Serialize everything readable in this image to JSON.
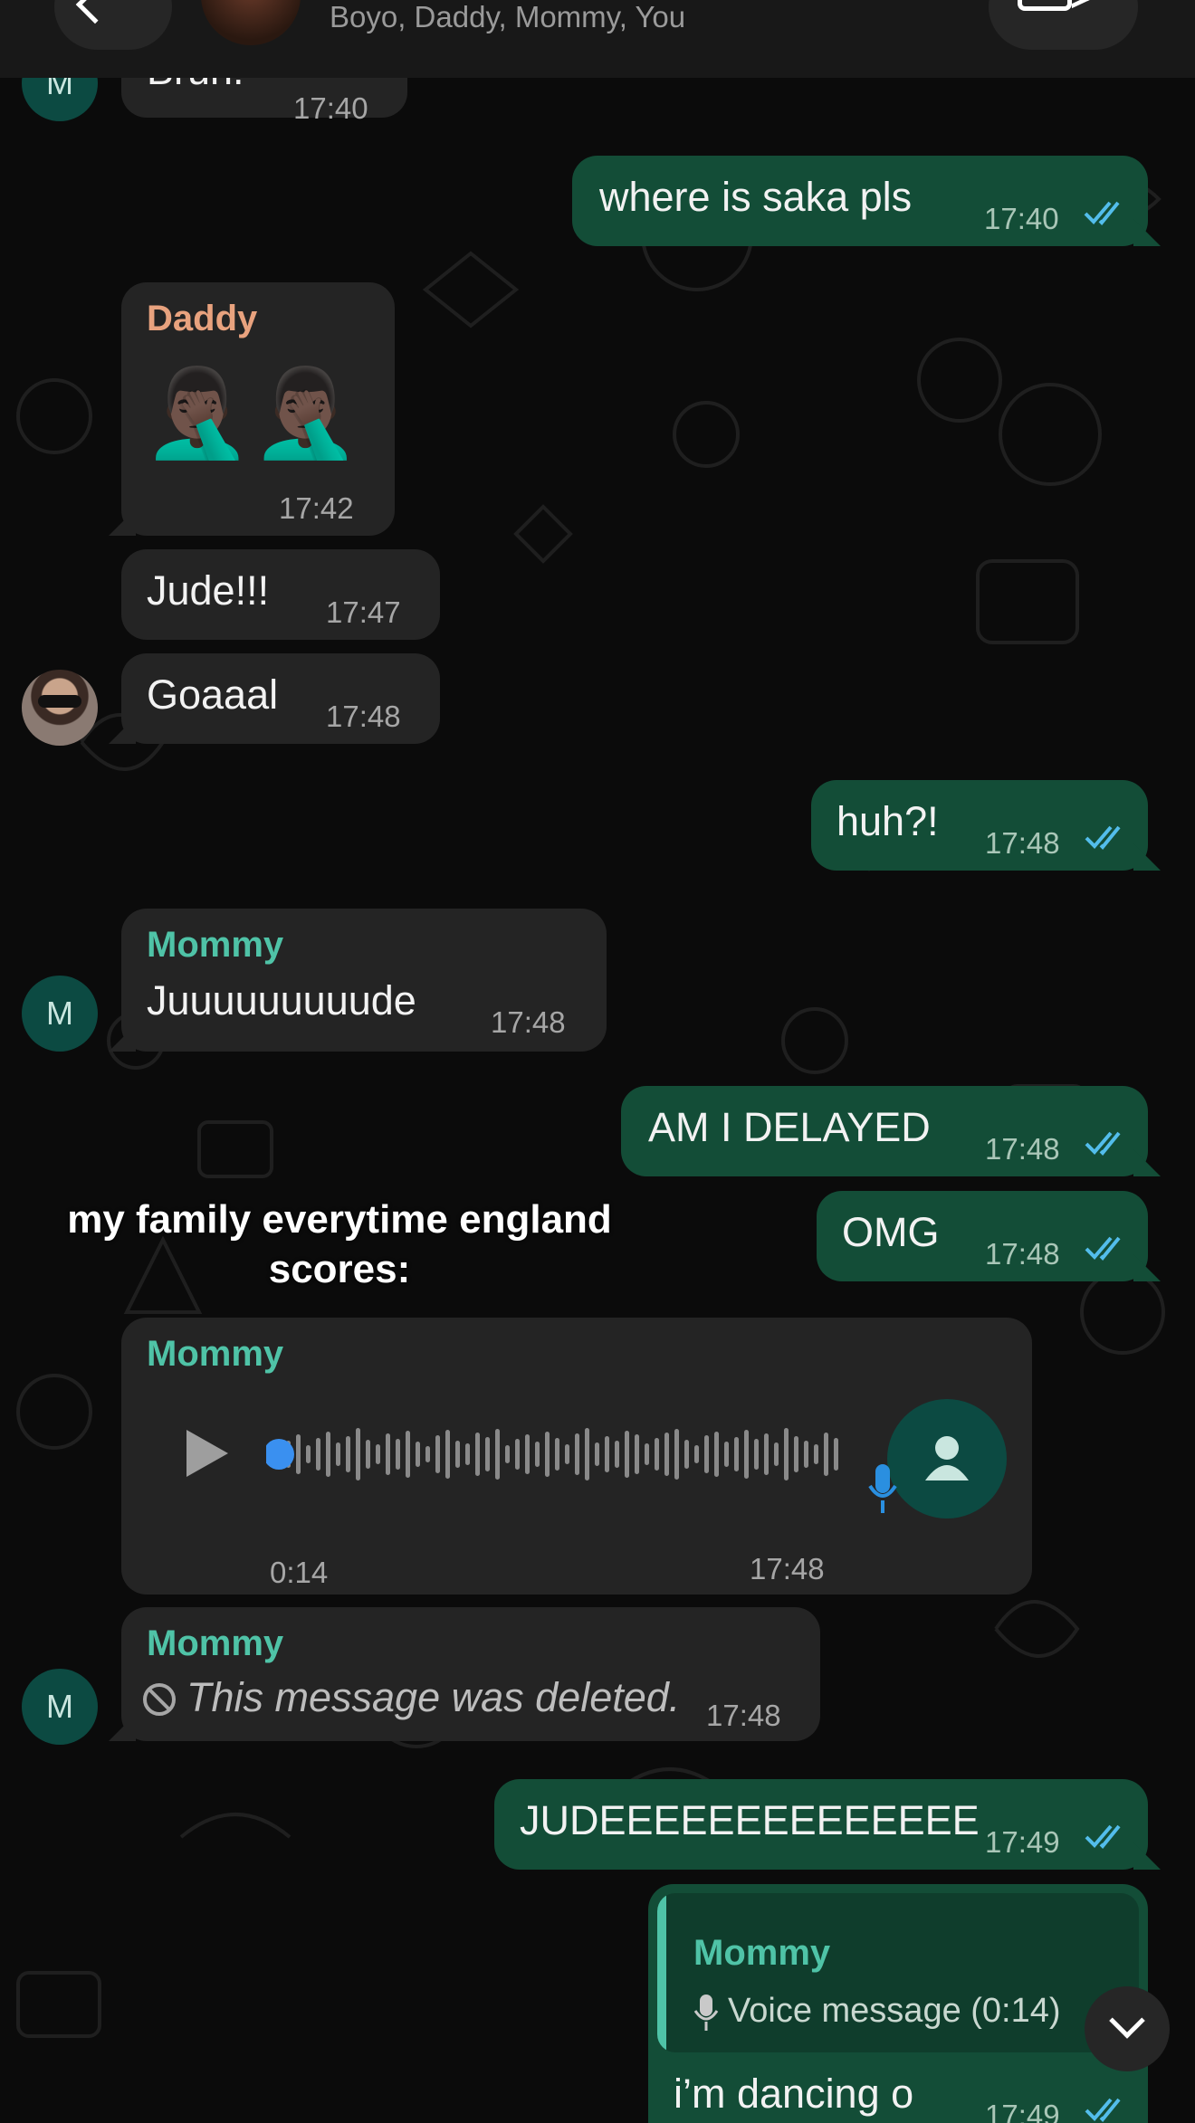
{
  "header": {
    "back_count": "2",
    "members": "Boyo, Daddy, Mommy, You"
  },
  "messages": {
    "m0": {
      "text": "Bruh.",
      "time": "17:40",
      "avatar_initial": "M"
    },
    "m1": {
      "text": "where is saka pls",
      "time": "17:40",
      "status": "read"
    },
    "m2": {
      "sender": "Daddy",
      "emoji": "🤦🏿‍♂️🤦🏿‍♂️",
      "time": "17:42"
    },
    "m3": {
      "text": "Jude!!!",
      "time": "17:47"
    },
    "m4": {
      "text": "Goaaal",
      "time": "17:48"
    },
    "m5": {
      "text": "huh?!",
      "time": "17:48",
      "status": "read"
    },
    "m6": {
      "sender": "Mommy",
      "text": "Juuuuuuuuude",
      "time": "17:48",
      "avatar_initial": "M"
    },
    "m7": {
      "text": "AM I DELAYED",
      "time": "17:48",
      "status": "read"
    },
    "m8": {
      "text": "OMG",
      "time": "17:48",
      "status": "read"
    },
    "m9": {
      "sender": "Mommy",
      "type": "voice",
      "duration": "0:14",
      "time": "17:48",
      "progress": 0
    },
    "m10": {
      "sender": "Mommy",
      "deleted_text": "This message was deleted.",
      "time": "17:48",
      "avatar_initial": "M"
    },
    "m11": {
      "text": "JUDEEEEEEEEEEEEEE",
      "time": "17:49",
      "status": "read"
    },
    "m12": {
      "quote_sender": "Mommy",
      "quote_text": "Voice message (0:14)",
      "text": "i’m dancing o",
      "time": "17:49",
      "status": "read"
    }
  },
  "overlay_caption": "my family everytime england scores:",
  "colors": {
    "background": "#0b0b0b",
    "incoming_bubble": "#242424",
    "outgoing_bubble": "#134d37",
    "read_ticks": "#53bdeb",
    "daddy_name": "#e8a27e",
    "mommy_name": "#4fc3a7"
  },
  "icons": [
    "chevron-left-icon",
    "video-camera-icon",
    "double-check-icon",
    "play-icon",
    "microphone-icon",
    "person-icon",
    "blocked-icon",
    "chevron-down-icon"
  ]
}
